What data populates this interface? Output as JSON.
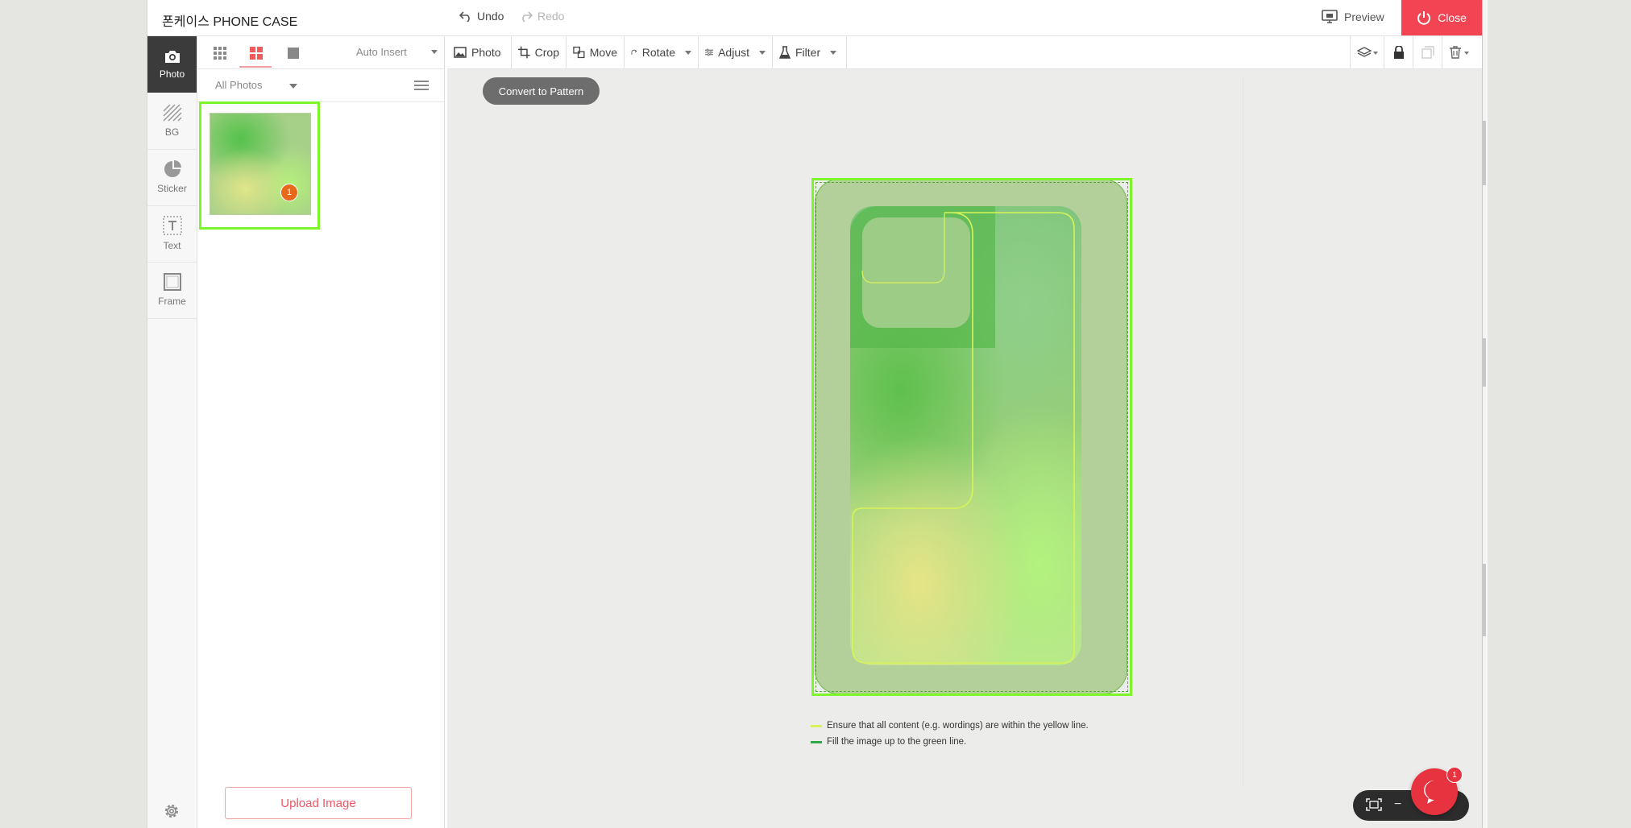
{
  "app": {
    "title": "폰케이스 PHONE CASE"
  },
  "titlebar": {
    "undo_label": "Undo",
    "redo_label": "Redo",
    "preview_label": "Preview",
    "close_label": "Close"
  },
  "sidebar": {
    "items": [
      {
        "label": "Photo",
        "icon": "camera-icon",
        "active": true
      },
      {
        "label": "BG",
        "icon": "hatch-pattern-icon",
        "active": false
      },
      {
        "label": "Sticker",
        "icon": "pie-sticker-icon",
        "active": false
      },
      {
        "label": "Text",
        "icon": "text-box-icon",
        "active": false
      },
      {
        "label": "Frame",
        "icon": "frame-icon",
        "active": false
      }
    ],
    "settings_icon": "gear-icon"
  },
  "photo_panel": {
    "view_tabs": [
      "grid-small-icon",
      "grid-large-icon",
      "single-view-icon"
    ],
    "auto_insert_label": "Auto Insert",
    "album_selected": "All Photos",
    "menu_icon": "hamburger-icon",
    "thumbnails": [
      {
        "badge": "1",
        "selected": true
      }
    ],
    "upload_label": "Upload Image"
  },
  "toolbar": {
    "tools": [
      {
        "label": "Photo",
        "icon": "image-icon",
        "has_dropdown": false
      },
      {
        "label": "Crop",
        "icon": "crop-icon",
        "has_dropdown": false
      },
      {
        "label": "Move",
        "icon": "move-icon",
        "has_dropdown": false
      },
      {
        "label": "Rotate",
        "icon": "rotate-icon",
        "has_dropdown": true
      },
      {
        "label": "Adjust",
        "icon": "sliders-icon",
        "has_dropdown": true
      },
      {
        "label": "Filter",
        "icon": "flask-icon",
        "has_dropdown": true
      }
    ],
    "right_icons": [
      "layers-icon",
      "lock-icon",
      "duplicate-icon",
      "trash-icon"
    ]
  },
  "canvas": {
    "convert_label": "Convert to Pattern",
    "legend": [
      {
        "text": "Ensure that all content (e.g. wordings) are within the yellow line.",
        "color": "#d8f35a"
      },
      {
        "text": "Fill the image up to the green line.",
        "color": "#2fa84a"
      }
    ],
    "zoom_minus_label": "−"
  },
  "chat": {
    "badge": "1"
  },
  "colors": {
    "accent_red": "#f24452",
    "selection_green": "#7cf52a",
    "safe_line_yellow": "#d8f35a",
    "bleed_line_green": "#2fa84a",
    "badge_orange": "#e8681c"
  }
}
